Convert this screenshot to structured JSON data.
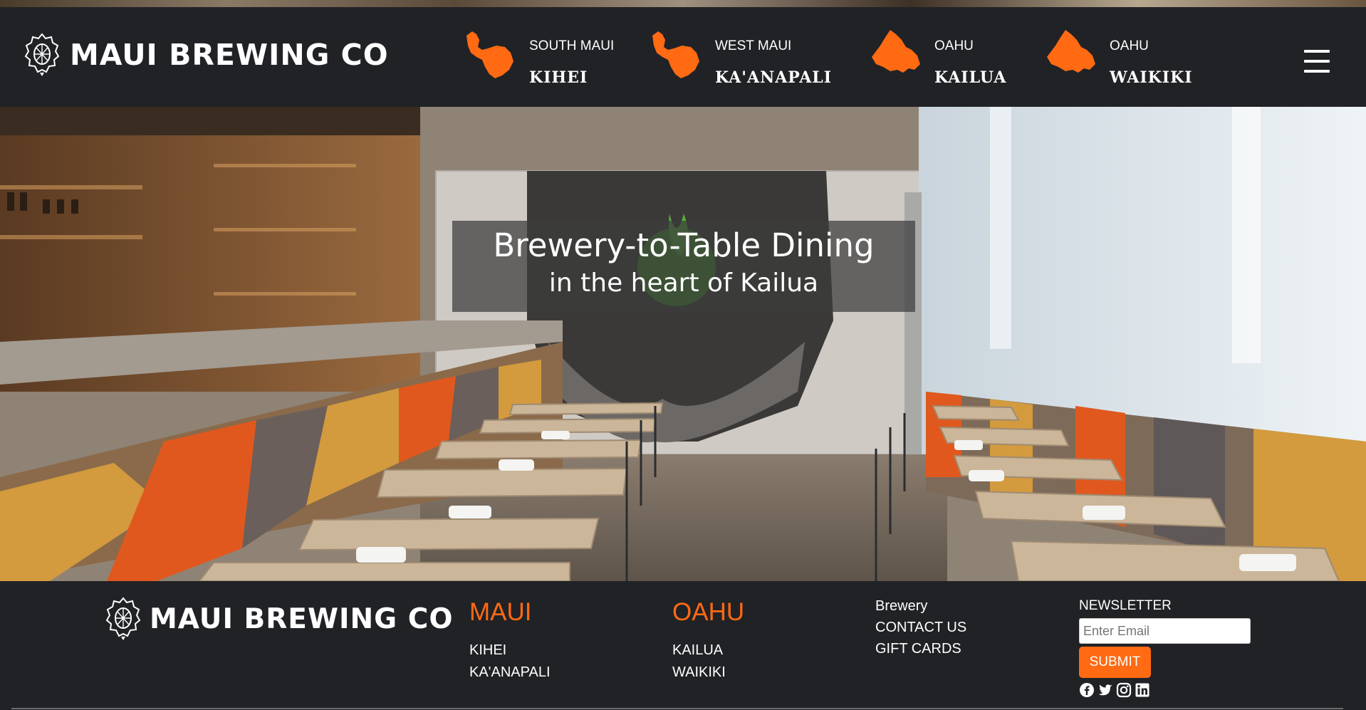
{
  "brand": {
    "name": "MAUI BREWING CO",
    "accent": "#ff6a13"
  },
  "header": {
    "locations": [
      {
        "region": "SOUTH MAUI",
        "town": "KIHEI",
        "icon": "maui-island-icon"
      },
      {
        "region": "WEST MAUI",
        "town": "KA'ANAPALI",
        "icon": "maui-island-icon"
      },
      {
        "region": "OAHU",
        "town": "KAILUA",
        "icon": "oahu-island-icon"
      },
      {
        "region": "OAHU",
        "town": "WAIKIKI",
        "icon": "oahu-island-icon"
      }
    ],
    "menu_icon": "hamburger-menu-icon"
  },
  "hero": {
    "title": "Brewery-to-Table Dining",
    "subtitle": "in the heart of Kailua"
  },
  "footer": {
    "maui": {
      "heading": "MAUI",
      "links": [
        "KIHEI",
        "KA'ANAPALI"
      ]
    },
    "oahu": {
      "heading": "OAHU",
      "links": [
        "KAILUA",
        "WAIKIKI"
      ]
    },
    "misc": {
      "links": [
        "Brewery",
        "CONTACT US",
        "GIFT CARDS"
      ]
    },
    "newsletter": {
      "label": "NEWSLETTER",
      "placeholder": "Enter Email",
      "submit": "SUBMIT"
    },
    "social": [
      "facebook-icon",
      "twitter-icon",
      "instagram-icon",
      "linkedin-icon"
    ]
  }
}
